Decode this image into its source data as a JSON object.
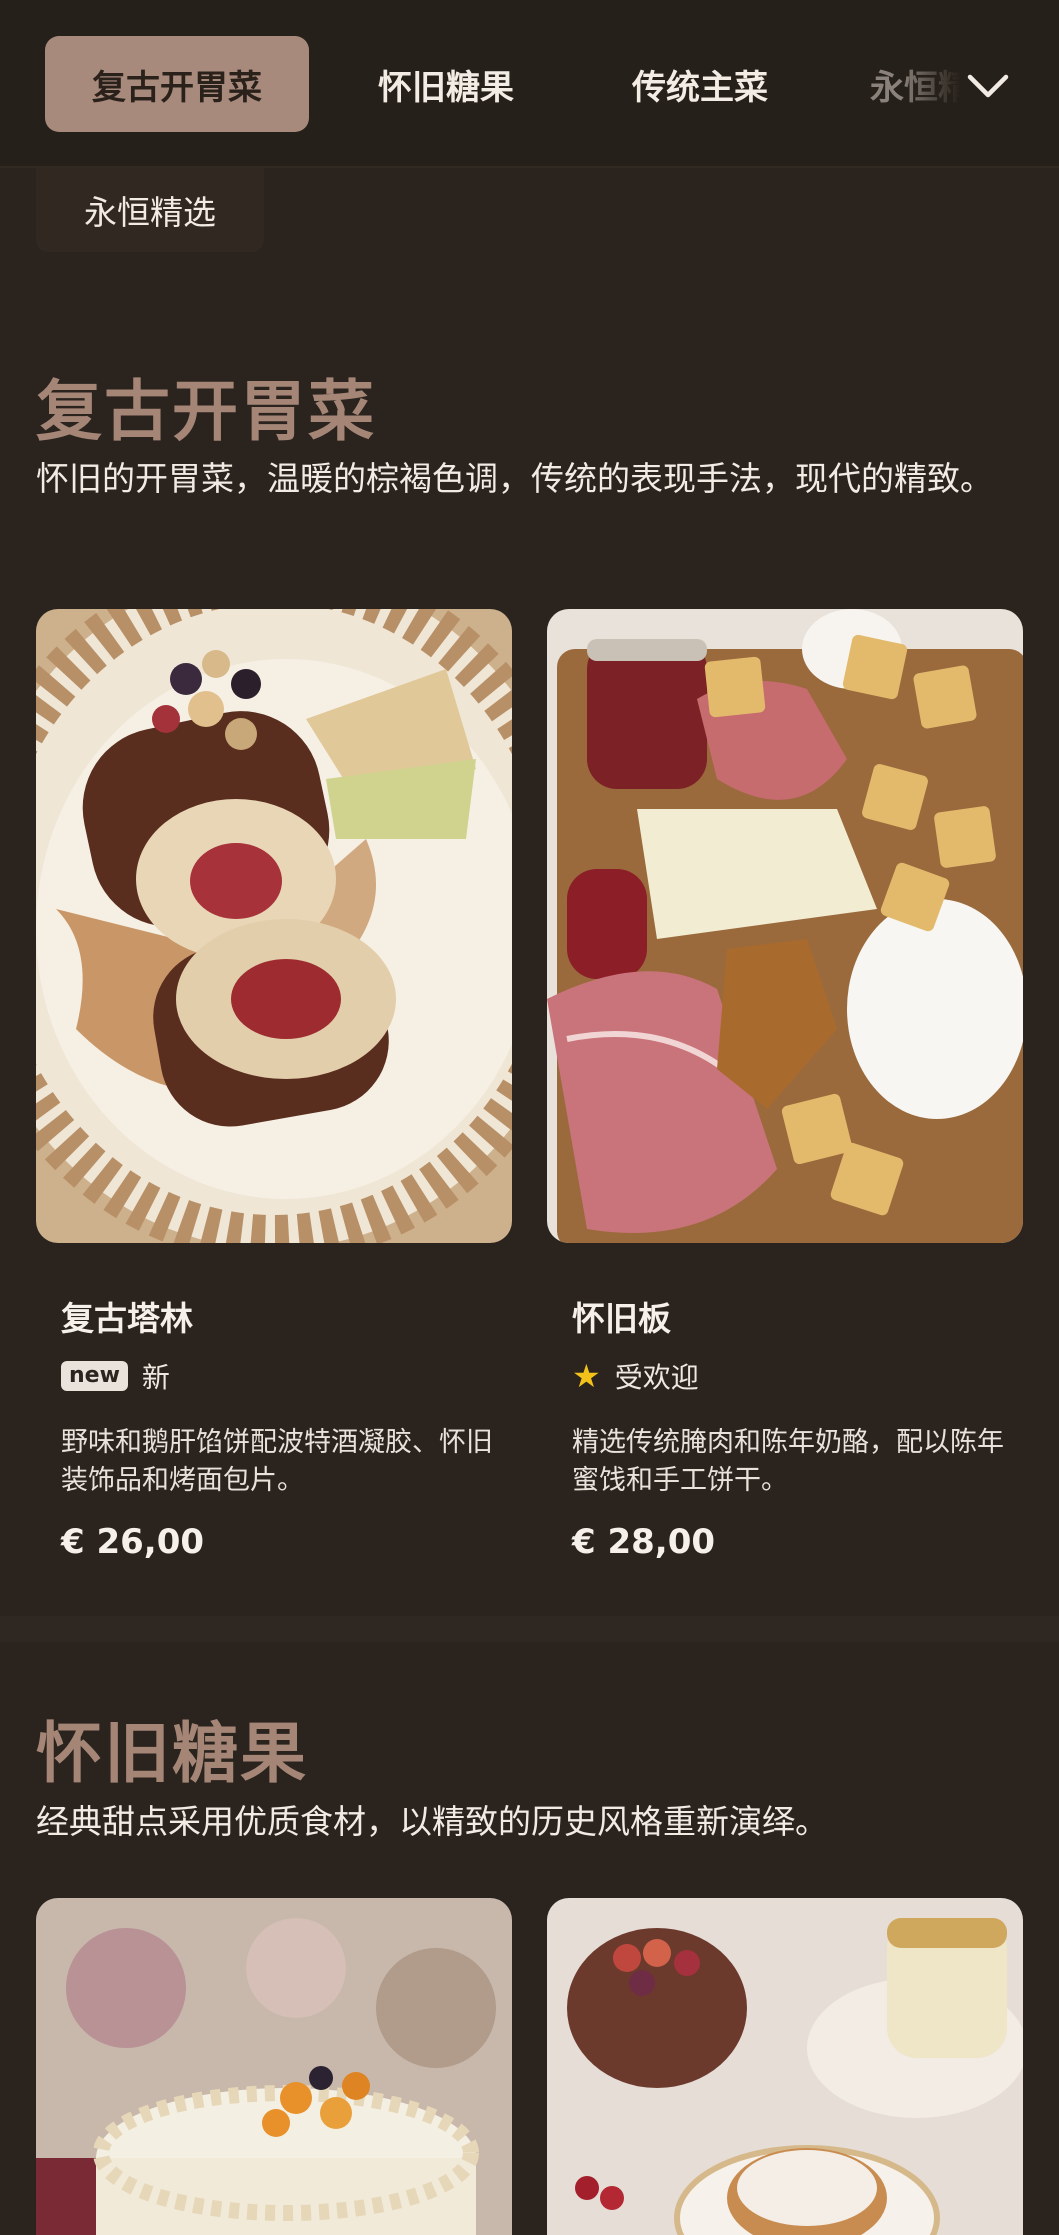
{
  "nav": {
    "tabs": [
      {
        "label": "复古开胃菜",
        "active": true
      },
      {
        "label": "怀旧糖果",
        "active": false
      },
      {
        "label": "传统主菜",
        "active": false
      },
      {
        "label": "永恒精选",
        "active": false
      }
    ],
    "overflow_icon": "chevron-down-icon",
    "overflow_chip": "永恒精选"
  },
  "sections": [
    {
      "title": "复古开胃菜",
      "description": "怀旧的开胃菜，温暖的棕褐色调，传统的表现手法，现代的精致。",
      "items": [
        {
          "name": "复古塔林",
          "badge_type": "new",
          "badge_chip": "new",
          "badge_label": "新",
          "description": "野味和鹅肝馅饼配波特酒凝胶、怀旧装饰品和烤面包片。",
          "price": "€ 26,00"
        },
        {
          "name": "怀旧板",
          "badge_type": "popular",
          "badge_label": "受欢迎",
          "description": "精选传统腌肉和陈年奶酪，配以陈年蜜饯和手工饼干。",
          "price": "€ 28,00"
        }
      ]
    },
    {
      "title": "怀旧糖果",
      "description": "经典甜点采用优质食材，以精致的历史风格重新演绎。"
    }
  ],
  "colors": {
    "background": "#2a231e",
    "accent": "#a58676",
    "active_tab": "#a88a7c",
    "star": "#f2c21b"
  }
}
